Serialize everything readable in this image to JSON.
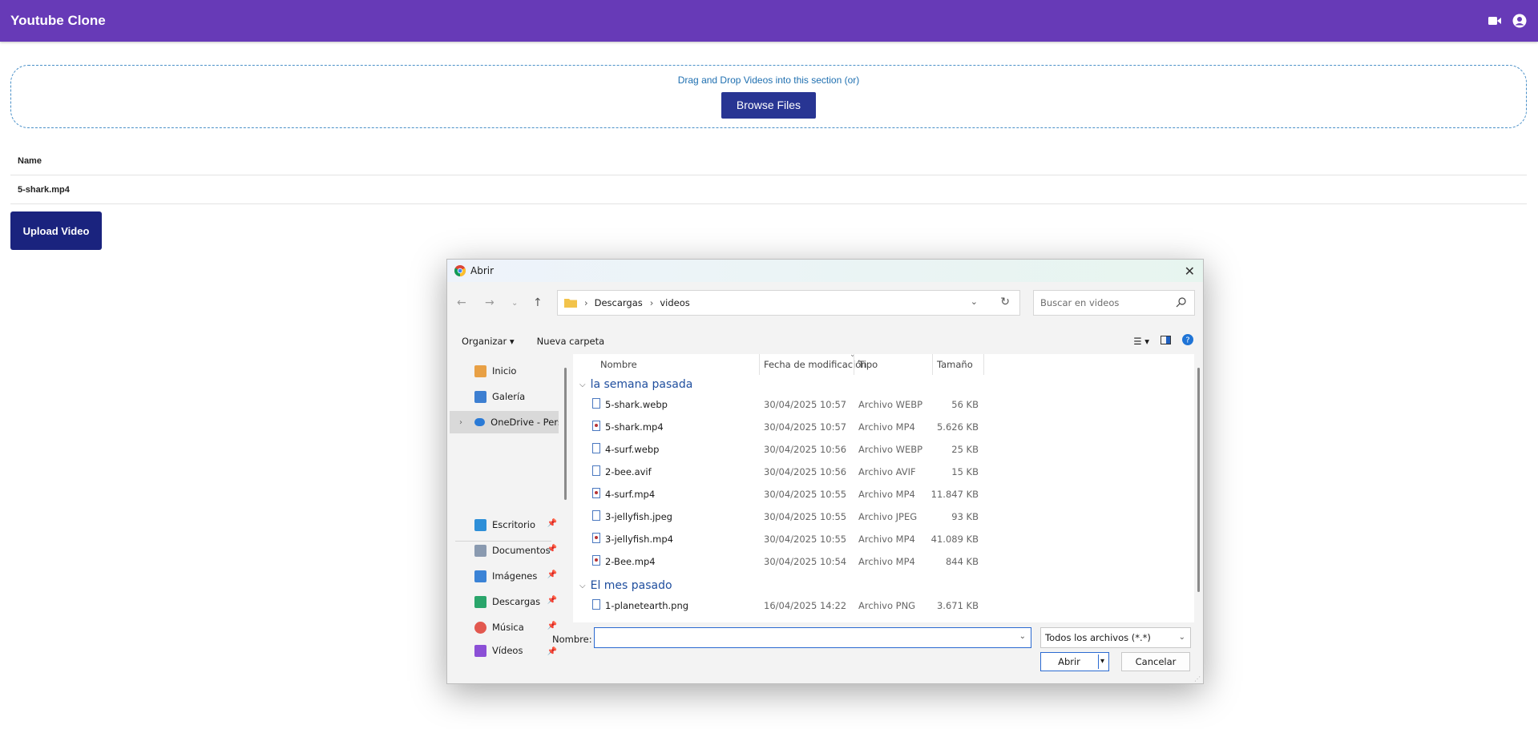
{
  "app": {
    "title": "Youtube Clone",
    "header_icons": [
      "video-camera-icon",
      "account-circle-icon"
    ],
    "accent_color": "#673ab7"
  },
  "dropzone": {
    "hint": "Drag and Drop Videos into this section (or)",
    "browse_label": "Browse Files"
  },
  "files_table": {
    "header": "Name",
    "rows": [
      "5-shark.mp4"
    ]
  },
  "upload_label": "Upload Video",
  "dialog": {
    "title": "Abrir",
    "breadcrumb": [
      "Descargas",
      "videos"
    ],
    "search_placeholder": "Buscar en videos",
    "toolbar": {
      "organize": "Organizar",
      "new_folder": "Nueva carpeta"
    },
    "nav": {
      "top": [
        "Inicio",
        "Galería",
        "OneDrive - Perso"
      ],
      "pinned": [
        "Escritorio",
        "Documentos",
        "Imágenes",
        "Descargas",
        "Música",
        "Vídeos"
      ]
    },
    "columns": {
      "name": "Nombre",
      "date": "Fecha de modificación",
      "type": "Tipo",
      "size": "Tamaño"
    },
    "groups": [
      {
        "label": "la semana pasada",
        "files": [
          {
            "name": "5-shark.webp",
            "date": "30/04/2025 10:57",
            "type": "Archivo WEBP",
            "size": "56 KB",
            "icon": "image-file-icon"
          },
          {
            "name": "5-shark.mp4",
            "date": "30/04/2025 10:57",
            "type": "Archivo MP4",
            "size": "5.626 KB",
            "icon": "video-file-icon"
          },
          {
            "name": "4-surf.webp",
            "date": "30/04/2025 10:56",
            "type": "Archivo WEBP",
            "size": "25 KB",
            "icon": "image-file-icon"
          },
          {
            "name": "2-bee.avif",
            "date": "30/04/2025 10:56",
            "type": "Archivo AVIF",
            "size": "15 KB",
            "icon": "image-file-icon"
          },
          {
            "name": "4-surf.mp4",
            "date": "30/04/2025 10:55",
            "type": "Archivo MP4",
            "size": "11.847 KB",
            "icon": "video-file-icon"
          },
          {
            "name": "3-jellyfish.jpeg",
            "date": "30/04/2025 10:55",
            "type": "Archivo JPEG",
            "size": "93 KB",
            "icon": "image-file-icon"
          },
          {
            "name": "3-jellyfish.mp4",
            "date": "30/04/2025 10:55",
            "type": "Archivo MP4",
            "size": "41.089 KB",
            "icon": "video-file-icon"
          },
          {
            "name": "2-Bee.mp4",
            "date": "30/04/2025 10:54",
            "type": "Archivo MP4",
            "size": "844 KB",
            "icon": "video-file-icon"
          }
        ]
      },
      {
        "label": "El mes pasado",
        "files": [
          {
            "name": "1-planetearth.png",
            "date": "16/04/2025 14:22",
            "type": "Archivo PNG",
            "size": "3.671 KB",
            "icon": "image-file-icon"
          }
        ]
      }
    ],
    "filename_label": "Nombre:",
    "filename_value": "",
    "filter_value": "Todos los archivos (*.*)",
    "open_label": "Abrir",
    "cancel_label": "Cancelar"
  }
}
